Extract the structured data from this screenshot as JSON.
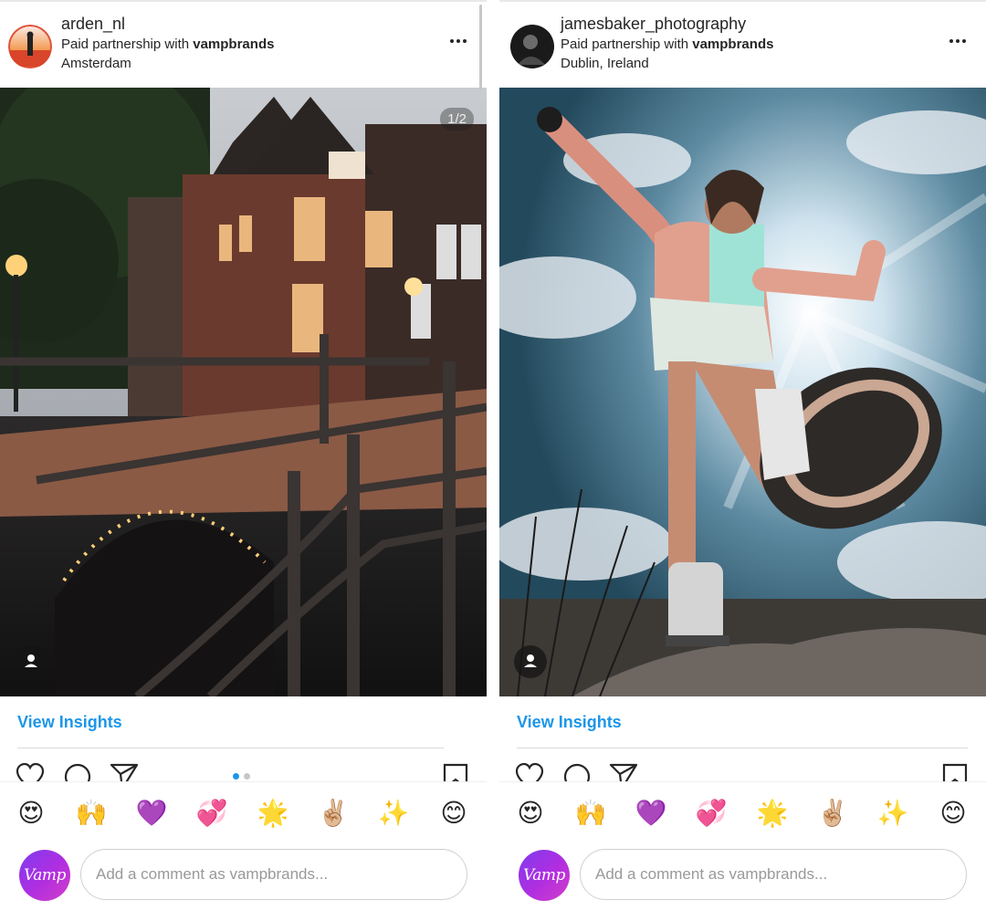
{
  "posts": [
    {
      "username": "arden_nl",
      "partnership_prefix": "Paid partnership with ",
      "partner": "vampbrands",
      "location": "Amsterdam",
      "media_counter": "1/2",
      "view_insights": "View Insights",
      "carousel_dots": 2,
      "carousel_active": 1
    },
    {
      "username": "jamesbaker_photography",
      "partnership_prefix": "Paid partnership with ",
      "partner": "vampbrands",
      "location": "Dublin, Ireland",
      "view_insights": "View Insights"
    }
  ],
  "quick_reactions": [
    "😍",
    "🙌",
    "💜",
    "💞",
    "🌟",
    "✌🏼",
    "✨",
    "😊"
  ],
  "comment_box": {
    "avatar_text": "Vamp",
    "placeholder": "Add a comment as vampbrands..."
  },
  "colors": {
    "link": "#1c96e8",
    "text": "#262626",
    "carousel_active": "#1c96e8",
    "carousel_inactive": "#c7c7c7",
    "vamp_gradient_start": "#7e3bf0",
    "vamp_gradient_end": "#d43ec7"
  },
  "icons": [
    "more-options-icon",
    "heart-icon",
    "comment-icon",
    "share-icon",
    "bookmark-icon",
    "tagged-user-icon"
  ]
}
